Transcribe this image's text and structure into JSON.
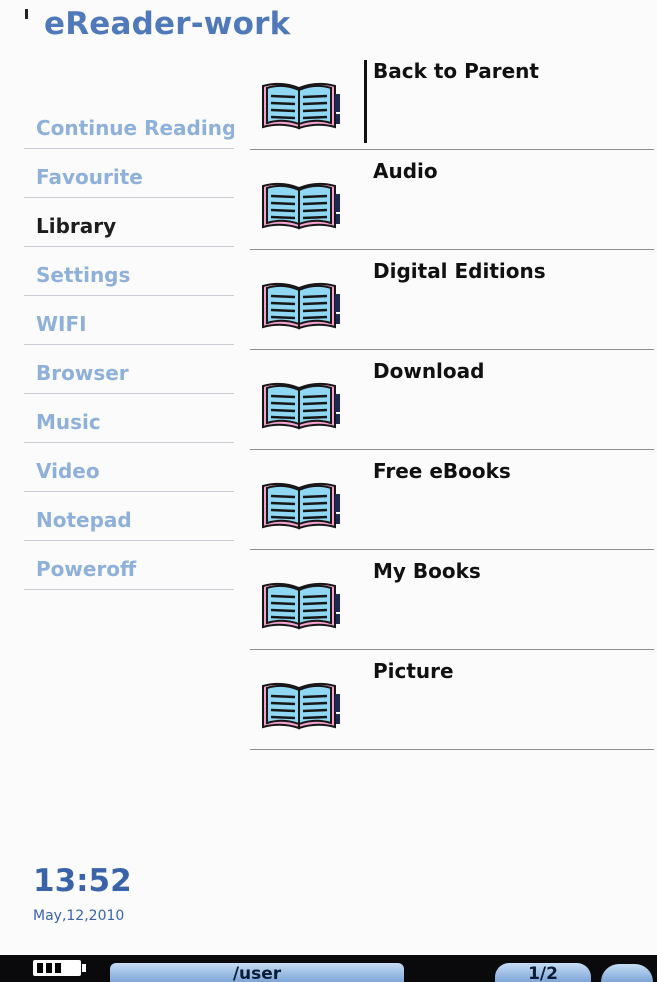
{
  "app": {
    "title": "eReader-work"
  },
  "sidebar": {
    "items": [
      {
        "label": "Continue Reading",
        "active": false
      },
      {
        "label": "Favourite",
        "active": false
      },
      {
        "label": "Library",
        "active": true
      },
      {
        "label": "Settings",
        "active": false
      },
      {
        "label": "WIFI",
        "active": false
      },
      {
        "label": "Browser",
        "active": false
      },
      {
        "label": "Music",
        "active": false
      },
      {
        "label": "Video",
        "active": false
      },
      {
        "label": "Notepad",
        "active": false
      },
      {
        "label": "Poweroff",
        "active": false
      }
    ]
  },
  "files": {
    "items": [
      {
        "label": "Back to Parent",
        "icon": "book-icon",
        "selected": true
      },
      {
        "label": "Audio",
        "icon": "book-icon"
      },
      {
        "label": "Digital Editions",
        "icon": "book-icon"
      },
      {
        "label": "Download",
        "icon": "book-icon"
      },
      {
        "label": "Free eBooks",
        "icon": "book-icon"
      },
      {
        "label": "My Books",
        "icon": "book-icon"
      },
      {
        "label": "Picture",
        "icon": "book-icon"
      }
    ]
  },
  "clock": {
    "time": "13:52",
    "date": "May,12,2010"
  },
  "statusbar": {
    "path": "/user",
    "page": "1/2",
    "battery_icon": "battery-icon"
  },
  "colors": {
    "title": "#4f79b8",
    "sidebar_inactive": "#8fb0d9",
    "sidebar_active": "#1d1d1d",
    "clock": "#3b64a8",
    "statusbar_bg": "#0a0a0c"
  }
}
